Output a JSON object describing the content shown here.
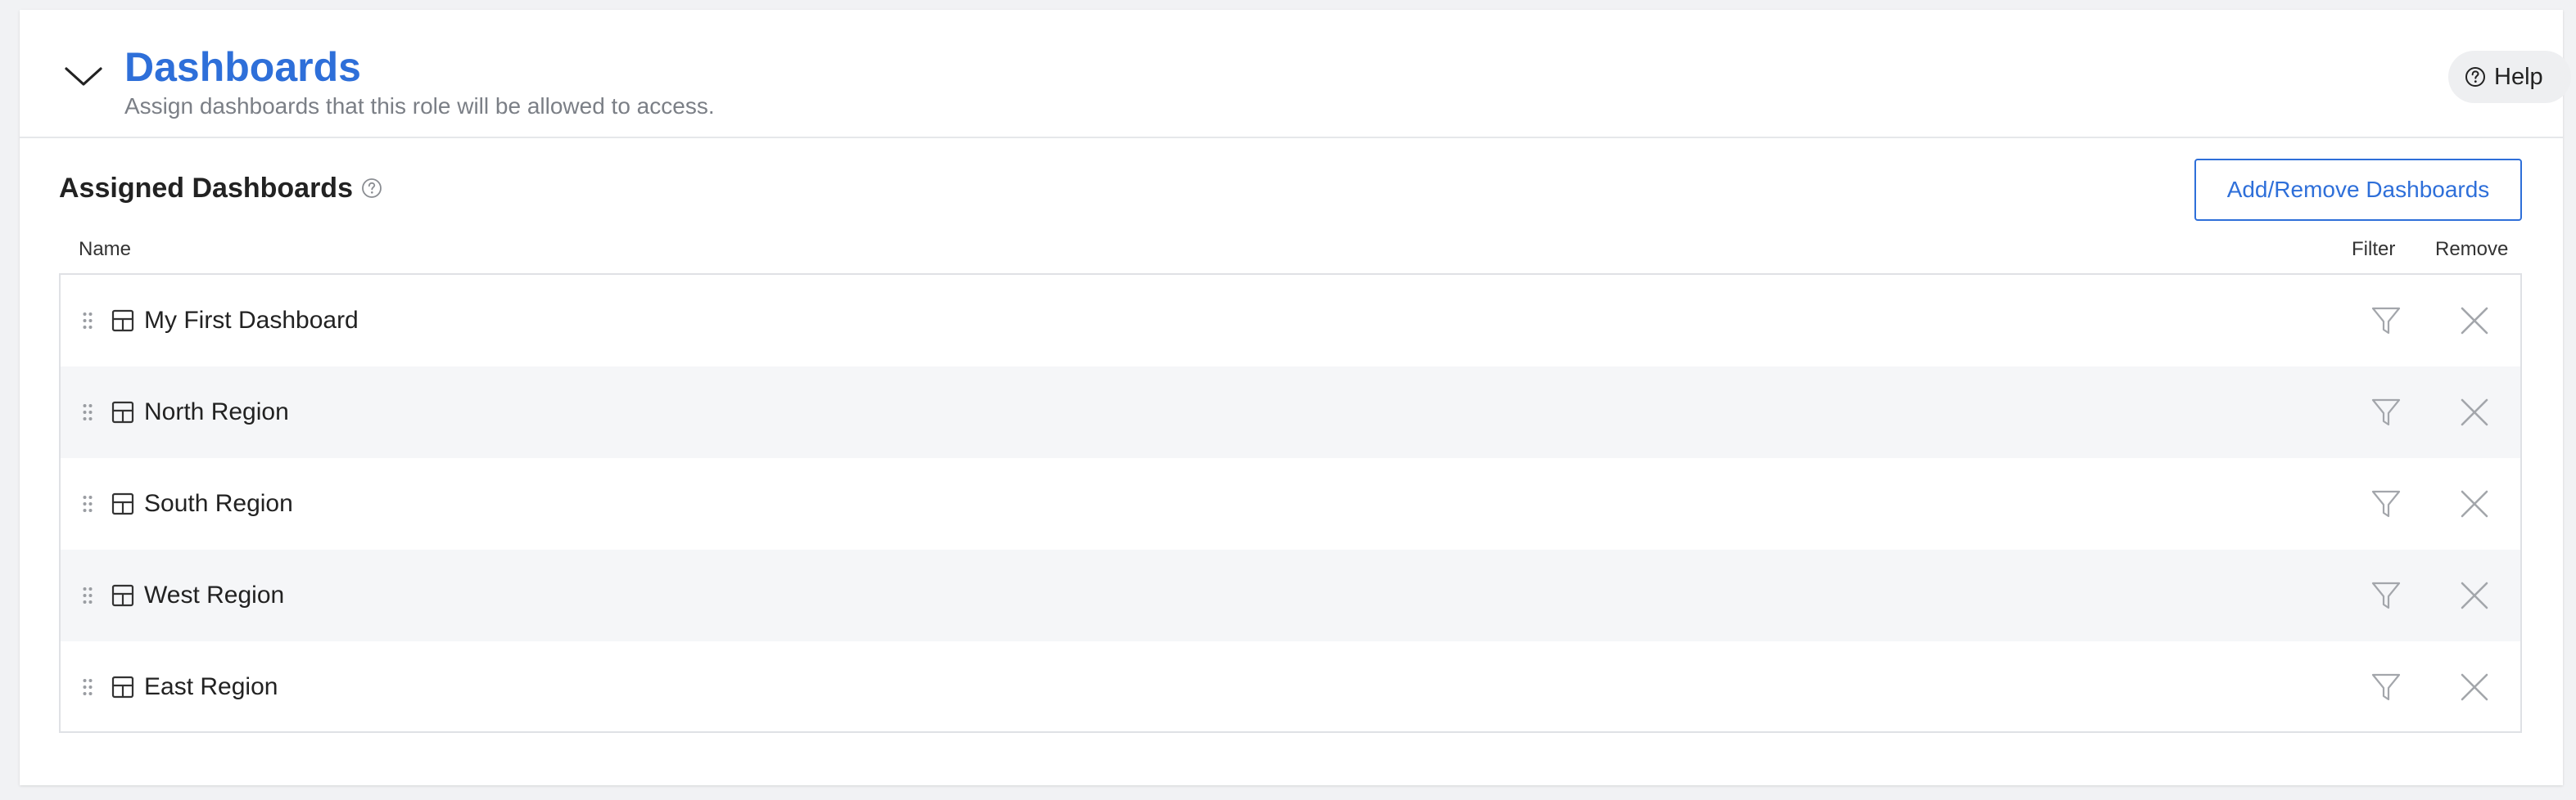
{
  "header": {
    "title": "Dashboards",
    "subtitle": "Assign dashboards that this role will be allowed to access.",
    "help_label": "Help"
  },
  "section": {
    "title": "Assigned Dashboards",
    "add_remove_label": "Add/Remove Dashboards"
  },
  "table": {
    "columns": {
      "name": "Name",
      "filter": "Filter",
      "remove": "Remove"
    },
    "rows": [
      {
        "name": "My First Dashboard"
      },
      {
        "name": "North Region"
      },
      {
        "name": "South Region"
      },
      {
        "name": "West Region"
      },
      {
        "name": "East Region"
      }
    ]
  },
  "icons": {
    "collapse": "chevron-down-icon",
    "help": "question-circle-icon",
    "info": "question-circle-icon",
    "drag": "drag-handle-icon",
    "dashboard": "dashboard-layout-icon",
    "filter": "filter-icon",
    "remove": "close-icon"
  },
  "colors": {
    "accent": "#2e6fd9",
    "muted_text": "#7b7f86",
    "row_alt": "#f5f6f8",
    "icon_gray": "#a3a6ab"
  }
}
